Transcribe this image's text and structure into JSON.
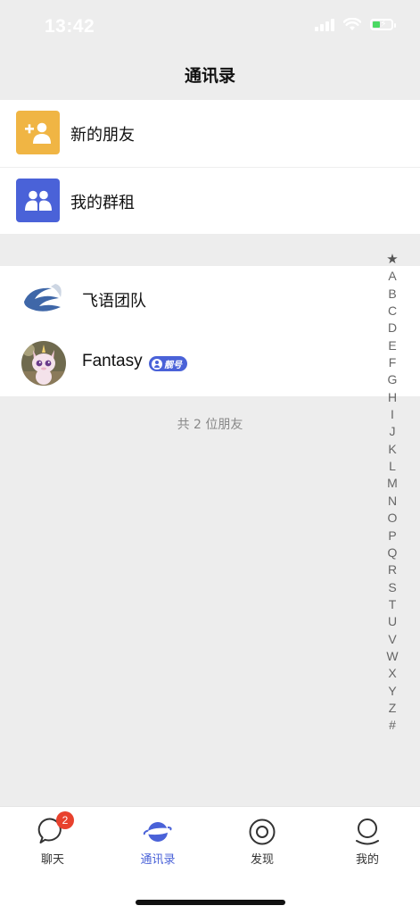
{
  "status_bar": {
    "time": "13:42"
  },
  "nav": {
    "title": "通讯录"
  },
  "top_entries": [
    {
      "label": "新的朋友",
      "icon": "add-friend-icon"
    },
    {
      "label": "我的群租",
      "icon": "group-icon"
    }
  ],
  "contacts": [
    {
      "name": "飞语团队",
      "avatar": "feiyu-logo"
    },
    {
      "name": "Fantasy",
      "avatar": "unicorn-avatar",
      "badge": "靓号"
    }
  ],
  "footer_count": "共 2 位朋友",
  "index": [
    "★",
    "A",
    "B",
    "C",
    "D",
    "E",
    "F",
    "G",
    "H",
    "I",
    "J",
    "K",
    "L",
    "M",
    "N",
    "O",
    "P",
    "Q",
    "R",
    "S",
    "T",
    "U",
    "V",
    "W",
    "X",
    "Y",
    "Z",
    "#"
  ],
  "tabbar": {
    "tabs": [
      {
        "label": "聊天",
        "icon": "chat-bubble-icon",
        "badge": "2"
      },
      {
        "label": "通讯录",
        "icon": "planet-icon",
        "active": true
      },
      {
        "label": "发现",
        "icon": "target-icon"
      },
      {
        "label": "我的",
        "icon": "profile-icon"
      }
    ]
  },
  "colors": {
    "accent": "#4a62d8",
    "yellow": "#f0b544",
    "badge_red": "#e8412d",
    "background": "#ededed"
  }
}
